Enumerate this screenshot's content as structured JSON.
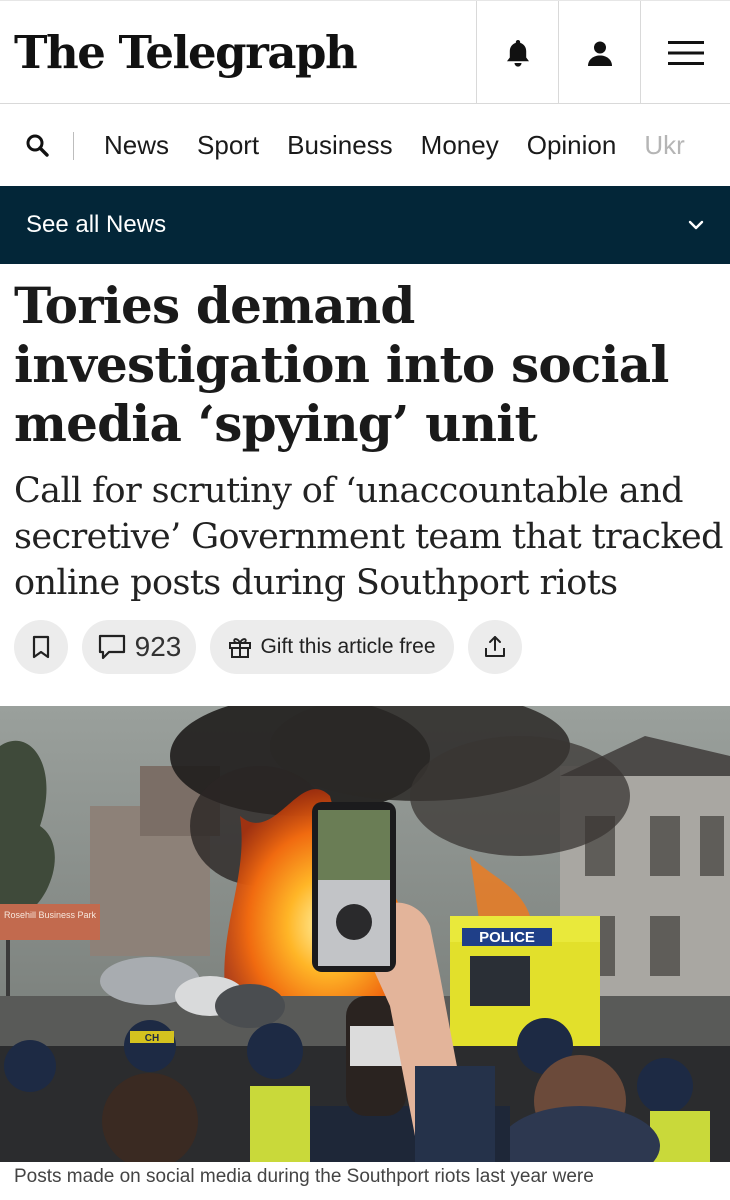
{
  "header": {
    "logo": "The Telegraph",
    "icons": [
      "bell-icon",
      "account-icon",
      "menu-icon"
    ]
  },
  "nav": {
    "items": [
      "News",
      "Sport",
      "Business",
      "Money",
      "Opinion",
      "Ukr"
    ]
  },
  "section_bar": {
    "label": "See all News",
    "background": "#032638"
  },
  "article": {
    "headline": "Tories demand investigation into social media ‘spying’ unit",
    "standfirst": "Call for scrutiny of ‘unaccountable and secretive’ Government team that tracked online posts during Southport riots",
    "comment_count": "923",
    "gift_label": "Gift this article free",
    "image_text": {
      "sign": "Rosehill Business Park",
      "van": "POLICE",
      "helmet": "CH"
    },
    "caption": "Posts made on social media during the Southport riots last year were"
  }
}
